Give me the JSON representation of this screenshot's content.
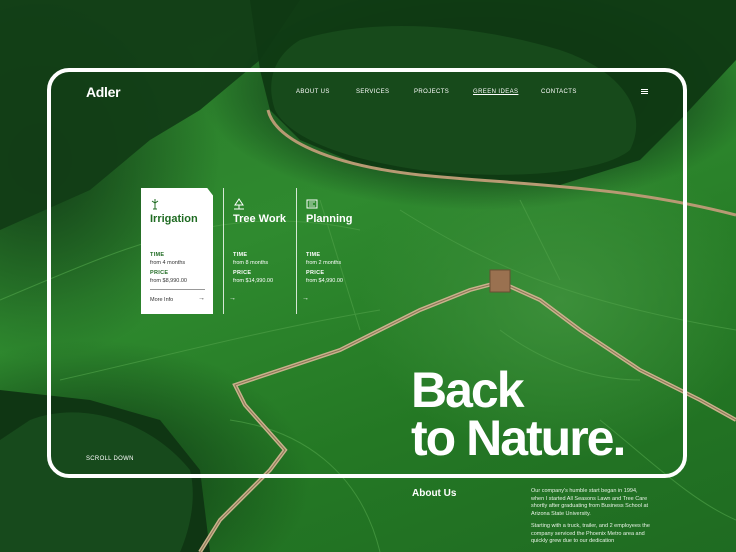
{
  "header": {
    "logo": "Adler",
    "nav": [
      "ABOUT US",
      "SERVICES",
      "PROJECTS",
      "GREEN IDEAS",
      "CONTACTS"
    ],
    "active_nav": "GREEN IDEAS"
  },
  "services": [
    {
      "title": "Irrigation",
      "icon": "sprinkler-icon",
      "time_label": "TIME",
      "time": "from 4 months",
      "price_label": "PRICE",
      "price": "from $8,990.00",
      "link": "More Info"
    },
    {
      "title": "Tree Work",
      "icon": "tree-icon",
      "time_label": "TIME",
      "time": "from 8 months",
      "price_label": "PRICE",
      "price": "from $14,990.00"
    },
    {
      "title": "Planning",
      "icon": "blueprint-icon",
      "time_label": "TIME",
      "time": "from 2 months",
      "price_label": "PRICE",
      "price": "from $4,990.00"
    }
  ],
  "hero": {
    "line1": "Back",
    "line2": "to Nature."
  },
  "scroll_label": "SCROLL DOWN",
  "about": {
    "heading": "About Us",
    "p1": "Our company's humble start began in 1994, when I started All Seasons Lawn and Tree Care shortly after graduating from Business School at Arizona State University.",
    "p2": "Starting with a truck, trailer, and 2 employees the company serviced the Phoenix Metro area and quickly grew due to our dedication"
  },
  "colors": {
    "brand_green": "#1f6b22",
    "frame": "#ffffff"
  }
}
